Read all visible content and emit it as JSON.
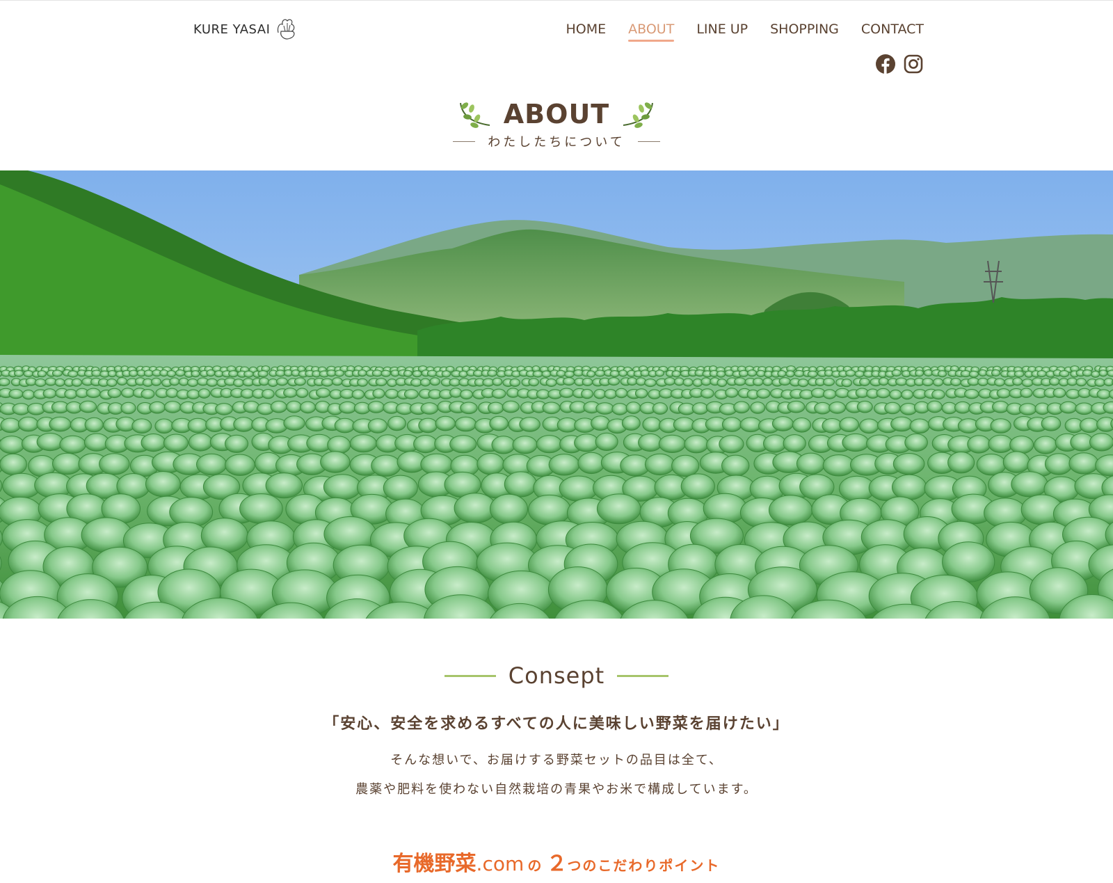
{
  "header": {
    "logo_text": "KURE YASAI",
    "nav": [
      {
        "label": "HOME"
      },
      {
        "label": "ABOUT",
        "active": true
      },
      {
        "label": "LINE UP"
      },
      {
        "label": "SHOPPING"
      },
      {
        "label": "CONTACT"
      }
    ],
    "social": [
      "facebook-icon",
      "instagram-icon"
    ]
  },
  "page_title": {
    "main": "ABOUT",
    "sub": "わたしたちについて"
  },
  "hero": {
    "image": "cabbage-field-mountain-landscape"
  },
  "concept": {
    "title": "Consept",
    "catch": "「安心、安全を求めるすべての人に美味しい野菜を届けたい」",
    "line1": "そんな想いで、お届けする野菜セットの品目は全て、",
    "line2": "農薬や肥料を使わない自然栽培の青果やお米で構成しています。"
  },
  "points": {
    "brand": "有機野菜",
    "com": ".com",
    "rest_pre": "の",
    "number": "２",
    "rest_post": "つのこだわりポイント"
  },
  "colors": {
    "brown": "#5a4231",
    "accent": "#f0a88a",
    "green_line": "#a6c46a",
    "orange": "#e8692a"
  }
}
